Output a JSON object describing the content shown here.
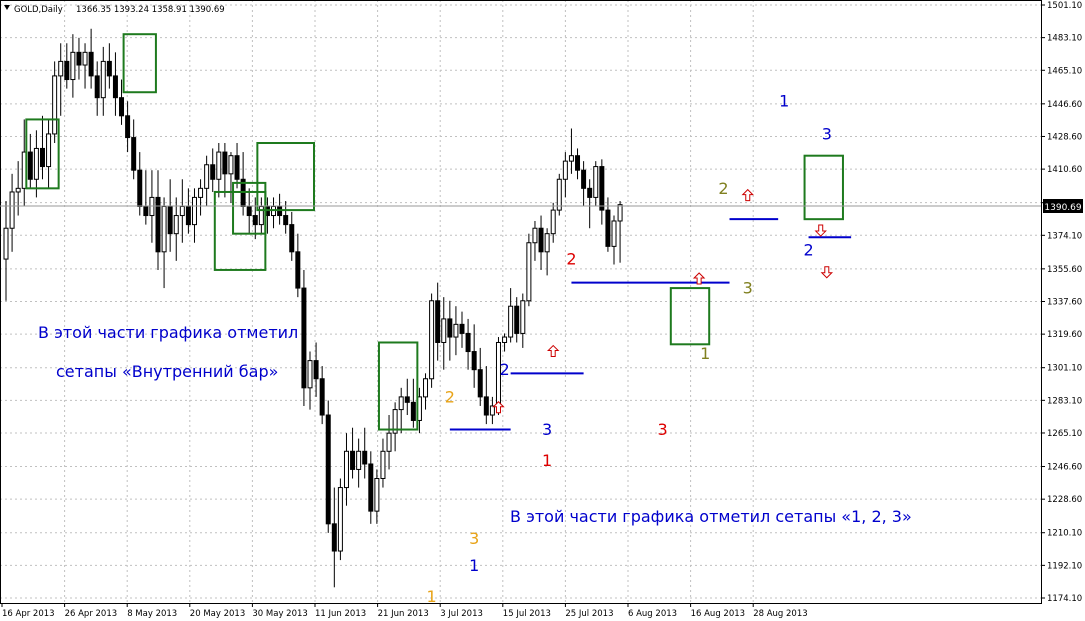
{
  "header": {
    "symbol": "GOLD,Daily",
    "ohlc": "1366.35 1393.24 1358.91 1390.69"
  },
  "annotations": {
    "inside_bar_line1": "В этой части графика отметил",
    "inside_bar_line2": "сетапы «Внутренний бар»",
    "setup_123_text": "В этой части графика отметил сетапы «1, 2, 3»"
  },
  "colors": {
    "background": "#ffffff",
    "grid": "#c0c0c0",
    "candle": "#000000",
    "inside_bar_box": "#1e7a1e",
    "level_line": "#0000cc",
    "text_blue": "#0000cc",
    "arrow": "#cc0000",
    "label_orange": "#e8a317",
    "label_red": "#dd0000",
    "label_olive": "#808020",
    "label_blue": "#0000cc"
  },
  "chart_data": {
    "type": "candlestick",
    "title": "GOLD,Daily",
    "ylim": [
      1174.1,
      1501.1
    ],
    "y_ticks": [
      "1501.10",
      "1483.10",
      "1465.10",
      "1446.60",
      "1428.60",
      "1410.60",
      "1392.10",
      "1374.10",
      "1355.60",
      "1337.60",
      "1319.60",
      "1301.10",
      "1283.10",
      "1265.10",
      "1246.60",
      "1228.60",
      "1210.10",
      "1192.10",
      "1174.10"
    ],
    "last_price": "1390.69",
    "x_tick_labels": [
      "16 Apr 2013",
      "26 Apr 2013",
      "8 May 2013",
      "20 May 2013",
      "30 May 2013",
      "11 Jun 2013",
      "21 Jun 2013",
      "3 Jul 2013",
      "15 Jul 2013",
      "25 Jul 2013",
      "6 Aug 2013",
      "16 Aug 2013",
      "28 Aug 2013"
    ],
    "candles": [
      [
        1361,
        1393,
        1338,
        1378
      ],
      [
        1378,
        1408,
        1365,
        1398
      ],
      [
        1398,
        1415,
        1385,
        1400
      ],
      [
        1400,
        1438,
        1390,
        1420
      ],
      [
        1420,
        1430,
        1400,
        1405
      ],
      [
        1405,
        1432,
        1395,
        1422
      ],
      [
        1422,
        1440,
        1405,
        1412
      ],
      [
        1412,
        1438,
        1400,
        1430
      ],
      [
        1430,
        1470,
        1425,
        1462
      ],
      [
        1462,
        1480,
        1440,
        1470
      ],
      [
        1470,
        1480,
        1455,
        1460
      ],
      [
        1460,
        1485,
        1450,
        1475
      ],
      [
        1475,
        1483,
        1460,
        1468
      ],
      [
        1468,
        1480,
        1455,
        1475
      ],
      [
        1475,
        1488,
        1455,
        1462
      ],
      [
        1462,
        1470,
        1440,
        1450
      ],
      [
        1450,
        1478,
        1440,
        1470
      ],
      [
        1470,
        1480,
        1455,
        1462
      ],
      [
        1462,
        1475,
        1440,
        1450
      ],
      [
        1450,
        1460,
        1435,
        1440
      ],
      [
        1440,
        1448,
        1420,
        1428
      ],
      [
        1428,
        1438,
        1405,
        1410
      ],
      [
        1410,
        1420,
        1385,
        1390
      ],
      [
        1390,
        1410,
        1380,
        1385
      ],
      [
        1385,
        1410,
        1370,
        1395
      ],
      [
        1395,
        1410,
        1355,
        1365
      ],
      [
        1365,
        1395,
        1345,
        1390
      ],
      [
        1390,
        1405,
        1365,
        1375
      ],
      [
        1375,
        1395,
        1360,
        1385
      ],
      [
        1385,
        1405,
        1370,
        1390
      ],
      [
        1390,
        1400,
        1375,
        1380
      ],
      [
        1380,
        1400,
        1370,
        1395
      ],
      [
        1395,
        1405,
        1385,
        1400
      ],
      [
        1400,
        1418,
        1390,
        1413
      ],
      [
        1413,
        1422,
        1398,
        1405
      ],
      [
        1405,
        1425,
        1395,
        1420
      ],
      [
        1420,
        1425,
        1395,
        1408
      ],
      [
        1408,
        1420,
        1392,
        1418
      ],
      [
        1418,
        1425,
        1400,
        1405
      ],
      [
        1405,
        1420,
        1385,
        1390
      ],
      [
        1390,
        1400,
        1375,
        1385
      ],
      [
        1385,
        1395,
        1372,
        1380
      ],
      [
        1380,
        1395,
        1375,
        1390
      ],
      [
        1390,
        1395,
        1375,
        1385
      ],
      [
        1385,
        1395,
        1378,
        1390
      ],
      [
        1390,
        1397,
        1380,
        1385
      ],
      [
        1385,
        1393,
        1375,
        1380
      ],
      [
        1380,
        1387,
        1360,
        1365
      ],
      [
        1365,
        1375,
        1340,
        1345
      ],
      [
        1345,
        1355,
        1280,
        1290
      ],
      [
        1290,
        1310,
        1278,
        1305
      ],
      [
        1305,
        1315,
        1285,
        1295
      ],
      [
        1295,
        1302,
        1270,
        1275
      ],
      [
        1275,
        1283,
        1210,
        1215
      ],
      [
        1215,
        1235,
        1180,
        1200
      ],
      [
        1200,
        1240,
        1195,
        1235
      ],
      [
        1235,
        1265,
        1225,
        1255
      ],
      [
        1255,
        1268,
        1240,
        1245
      ],
      [
        1245,
        1262,
        1235,
        1255
      ],
      [
        1255,
        1268,
        1240,
        1248
      ],
      [
        1248,
        1255,
        1215,
        1222
      ],
      [
        1222,
        1245,
        1215,
        1240
      ],
      [
        1240,
        1262,
        1235,
        1255
      ],
      [
        1255,
        1275,
        1245,
        1265
      ],
      [
        1265,
        1282,
        1255,
        1278
      ],
      [
        1278,
        1290,
        1265,
        1285
      ],
      [
        1285,
        1295,
        1275,
        1282
      ],
      [
        1282,
        1295,
        1268,
        1272
      ],
      [
        1272,
        1290,
        1265,
        1285
      ],
      [
        1285,
        1298,
        1278,
        1295
      ],
      [
        1295,
        1342,
        1290,
        1338
      ],
      [
        1338,
        1348,
        1305,
        1315
      ],
      [
        1315,
        1340,
        1300,
        1328
      ],
      [
        1328,
        1338,
        1305,
        1318
      ],
      [
        1318,
        1335,
        1308,
        1325
      ],
      [
        1325,
        1332,
        1312,
        1320
      ],
      [
        1320,
        1328,
        1300,
        1310
      ],
      [
        1310,
        1325,
        1290,
        1300
      ],
      [
        1300,
        1312,
        1280,
        1285
      ],
      [
        1285,
        1302,
        1270,
        1275
      ],
      [
        1275,
        1285,
        1270,
        1280
      ],
      [
        1280,
        1318,
        1275,
        1315
      ],
      [
        1315,
        1320,
        1310,
        1318
      ],
      [
        1318,
        1345,
        1315,
        1335
      ],
      [
        1335,
        1340,
        1315,
        1320
      ],
      [
        1320,
        1342,
        1312,
        1338
      ],
      [
        1338,
        1375,
        1335,
        1370
      ],
      [
        1370,
        1382,
        1360,
        1378
      ],
      [
        1378,
        1385,
        1355,
        1365
      ],
      [
        1365,
        1378,
        1352,
        1375
      ],
      [
        1375,
        1392,
        1370,
        1388
      ],
      [
        1388,
        1408,
        1385,
        1405
      ],
      [
        1405,
        1420,
        1395,
        1415
      ],
      [
        1415,
        1433,
        1408,
        1418
      ],
      [
        1418,
        1422,
        1405,
        1410
      ],
      [
        1410,
        1415,
        1390,
        1400
      ],
      [
        1400,
        1405,
        1378,
        1395
      ],
      [
        1395,
        1415,
        1390,
        1412
      ],
      [
        1412,
        1416,
        1380,
        1388
      ],
      [
        1388,
        1395,
        1365,
        1368
      ],
      [
        1368,
        1385,
        1358,
        1382
      ],
      [
        1382,
        1393,
        1359,
        1391
      ]
    ],
    "inside_bar_boxes": [
      {
        "from": 4,
        "to": 8,
        "high": 1438,
        "low": 1400
      },
      {
        "from": 20,
        "to": 24,
        "high": 1485,
        "low": 1453
      },
      {
        "from": 35,
        "to": 42,
        "high": 1398,
        "low": 1355
      },
      {
        "from": 38,
        "to": 42,
        "high": 1403,
        "low": 1375
      },
      {
        "from": 42,
        "to": 50,
        "high": 1425,
        "low": 1388
      },
      {
        "from": 62,
        "to": 67,
        "high": 1315,
        "low": 1267
      },
      {
        "from": 110,
        "to": 115,
        "high": 1345,
        "low": 1314
      },
      {
        "from": 132,
        "to": 137,
        "high": 1418,
        "low": 1383
      }
    ],
    "level_lines": [
      {
        "from": 73,
        "to": 83,
        "price": 1267
      },
      {
        "from": 83,
        "to": 95,
        "price": 1298
      },
      {
        "from": 93,
        "to": 119,
        "price": 1348
      },
      {
        "from": 119,
        "to": 127,
        "price": 1383
      },
      {
        "from": 132,
        "to": 139,
        "price": 1373
      }
    ],
    "arrows": [
      {
        "idx": 81,
        "price": 1279,
        "dir": "up"
      },
      {
        "idx": 90,
        "price": 1310,
        "dir": "up"
      },
      {
        "idx": 114,
        "price": 1350,
        "dir": "up"
      },
      {
        "idx": 122,
        "price": 1396,
        "dir": "up"
      },
      {
        "idx": 134,
        "price": 1377,
        "dir": "down"
      },
      {
        "idx": 135,
        "price": 1354,
        "dir": "down"
      }
    ],
    "point_labels": [
      {
        "text": "1",
        "idx": 70,
        "price": 1172,
        "color": "label_orange"
      },
      {
        "text": "2",
        "idx": 73,
        "price": 1282,
        "color": "label_orange"
      },
      {
        "text": "3",
        "idx": 77,
        "price": 1204,
        "color": "label_orange"
      },
      {
        "text": "1",
        "idx": 77,
        "price": 1189,
        "color": "label_blue"
      },
      {
        "text": "2",
        "idx": 82,
        "price": 1297,
        "color": "label_blue"
      },
      {
        "text": "3",
        "idx": 89,
        "price": 1264,
        "color": "label_blue"
      },
      {
        "text": "1",
        "idx": 89,
        "price": 1247,
        "color": "label_red"
      },
      {
        "text": "2",
        "idx": 93,
        "price": 1358,
        "color": "label_red"
      },
      {
        "text": "3",
        "idx": 108,
        "price": 1264,
        "color": "label_red"
      },
      {
        "text": "1",
        "idx": 115,
        "price": 1306,
        "color": "label_olive"
      },
      {
        "text": "2",
        "idx": 118,
        "price": 1397,
        "color": "label_olive"
      },
      {
        "text": "3",
        "idx": 122,
        "price": 1342,
        "color": "label_olive"
      },
      {
        "text": "1",
        "idx": 128,
        "price": 1445,
        "color": "label_blue"
      },
      {
        "text": "2",
        "idx": 132,
        "price": 1363,
        "color": "label_blue"
      },
      {
        "text": "3",
        "idx": 135,
        "price": 1427,
        "color": "label_blue"
      }
    ]
  }
}
